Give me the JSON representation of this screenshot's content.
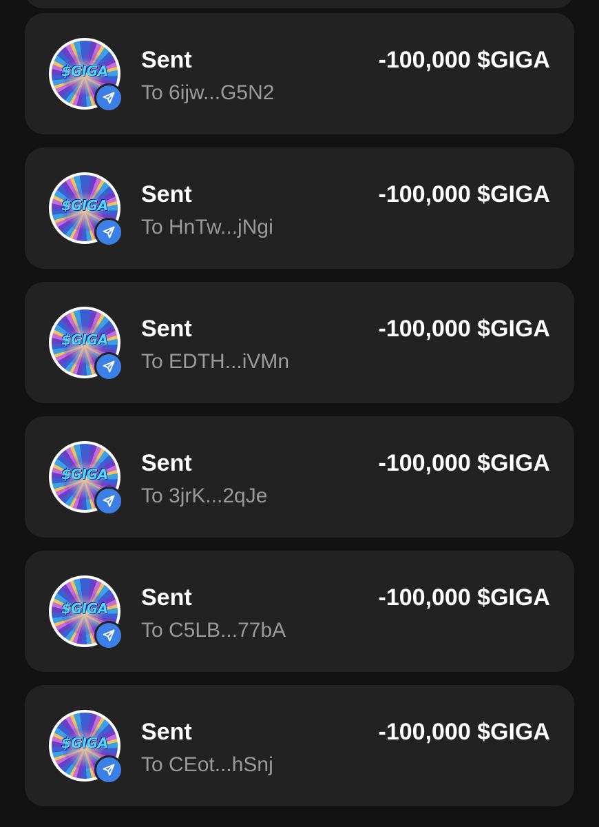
{
  "token": {
    "symbol_label": "$GIGA",
    "icon": "giga-token-icon",
    "badge_icon": "send-arrow-icon",
    "badge_color": "#3c7fe6"
  },
  "transactions": [
    {
      "title": "Sent",
      "subtitle": "To 6ijw...G5N2",
      "amount": "-100,000 $GIGA"
    },
    {
      "title": "Sent",
      "subtitle": "To HnTw...jNgi",
      "amount": "-100,000 $GIGA"
    },
    {
      "title": "Sent",
      "subtitle": "To EDTH...iVMn",
      "amount": "-100,000 $GIGA"
    },
    {
      "title": "Sent",
      "subtitle": "To 3jrK...2qJe",
      "amount": "-100,000 $GIGA"
    },
    {
      "title": "Sent",
      "subtitle": "To C5LB...77bA",
      "amount": "-100,000 $GIGA"
    },
    {
      "title": "Sent",
      "subtitle": "To CEot...hSnj",
      "amount": "-100,000 $GIGA"
    }
  ],
  "colors": {
    "background": "#121212",
    "card": "#222222",
    "title_text": "#ffffff",
    "subtitle_text": "#9a9a9a"
  }
}
